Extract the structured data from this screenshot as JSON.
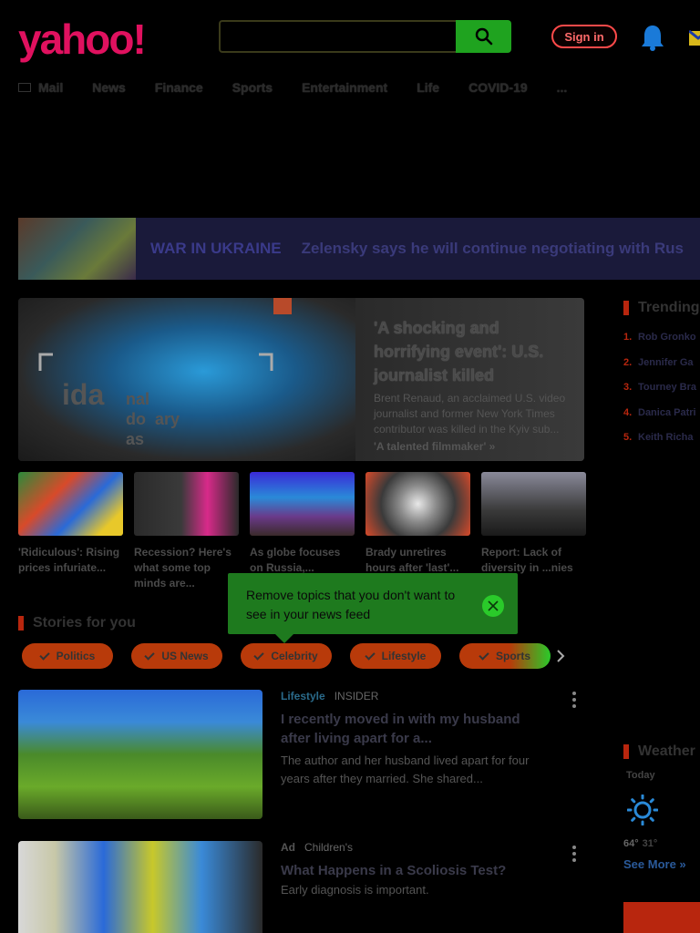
{
  "header": {
    "logo": "yahoo!",
    "search_placeholder": "",
    "sign_in": "Sign in"
  },
  "nav": {
    "items": [
      "Mail",
      "News",
      "Finance",
      "Sports",
      "Entertainment",
      "Life",
      "COVID-19",
      "..."
    ]
  },
  "banner": {
    "label": "WAR IN UKRAINE",
    "headline": "Zelensky says he will continue negotiating with Rus"
  },
  "hero": {
    "title": "'A shocking and horrifying event': U.S. journalist killed",
    "description": "Brent Renaud, an acclaimed U.S. video journalist and former New York Times contributor was killed in the Kyiv sub...",
    "link": "'A talented filmmaker' »",
    "overlay_big": "ida",
    "overlay_small": "nal\ndo  ary\nas"
  },
  "thumbs": [
    {
      "caption": "'Ridiculous': Rising prices infuriate..."
    },
    {
      "caption": "Recession? Here's what some top minds are..."
    },
    {
      "caption": "As globe focuses on Russia,..."
    },
    {
      "caption": "Brady unretires hours after 'last'..."
    },
    {
      "caption": "Report: Lack of diversity in ...nies cost..."
    }
  ],
  "tooltip": {
    "text": "Remove topics that you don't want to see in your news feed"
  },
  "stories_section": {
    "title": "Stories for you",
    "chips": [
      "Politics",
      "US News",
      "Celebrity",
      "Lifestyle",
      "Sports"
    ]
  },
  "stories": [
    {
      "category": "Lifestyle",
      "source": "INSIDER",
      "title": "I recently moved in with my husband after living apart for a...",
      "description": "The author and her husband lived apart for four years after they married. She shared..."
    },
    {
      "ad_label": "Ad",
      "source": "Children's",
      "title": "What Happens in a Scoliosis Test?",
      "description": "Early diagnosis is important."
    }
  ],
  "sidebar": {
    "trending_title": "Trending",
    "trending": [
      {
        "num": "1.",
        "name": "Rob Gronko"
      },
      {
        "num": "2.",
        "name": "Jennifer Ga"
      },
      {
        "num": "3.",
        "name": "Tourney Bra"
      },
      {
        "num": "4.",
        "name": "Danica Patri"
      },
      {
        "num": "5.",
        "name": "Keith Richa"
      }
    ],
    "weather_title": "Weather",
    "weather_day": "Today",
    "temp_high": "64°",
    "temp_low": "31°",
    "see_more": "See More »"
  },
  "colors": {
    "accent_red": "#b8260e",
    "search_green": "#1fa31f",
    "tooltip_green": "#1e7a1e"
  }
}
